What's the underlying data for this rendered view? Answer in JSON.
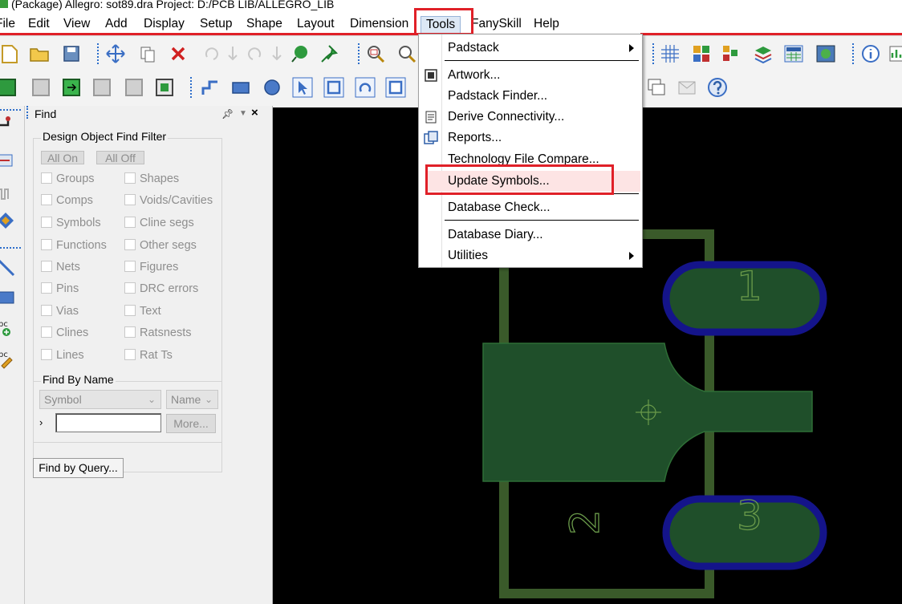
{
  "window": {
    "title": "(Package) Allegro: sot89.dra  Project: D:/PCB LIB/ALLEGRO_LIB"
  },
  "menubar": {
    "items": [
      "File",
      "Edit",
      "View",
      "Add",
      "Display",
      "Setup",
      "Shape",
      "Layout",
      "Dimension",
      "Tools",
      "FanySkill",
      "Help"
    ]
  },
  "tools_menu": {
    "items": [
      {
        "label": "Padstack",
        "submenu": true
      },
      {
        "label": "Artwork..."
      },
      {
        "label": "Padstack Finder..."
      },
      {
        "label": "Derive Connectivity..."
      },
      {
        "label": "Reports..."
      },
      {
        "label": "Technology File Compare..."
      },
      {
        "label": "Update Symbols...",
        "highlighted": true
      },
      {
        "label": "Database Check..."
      },
      {
        "label": "Database Diary..."
      },
      {
        "label": "Utilities",
        "submenu": true
      }
    ]
  },
  "find_panel": {
    "title": "Find",
    "pin_icon": "pin-icon",
    "close_icon": "close-icon",
    "filter_group_title": "Design Object Find Filter",
    "all_on_label": "All On",
    "all_off_label": "All Off",
    "checkboxes_left": [
      "Groups",
      "Comps",
      "Symbols",
      "Functions",
      "Nets",
      "Pins",
      "Vias",
      "Clines",
      "Lines"
    ],
    "checkboxes_right": [
      "Shapes",
      "Voids/Cavities",
      "Cline segs",
      "Other segs",
      "Figures",
      "DRC errors",
      "Text",
      "Ratsnests",
      "Rat Ts"
    ],
    "find_by_name_title": "Find By Name",
    "type_select": "Symbol",
    "name_select": "Name",
    "name_input_value": "",
    "more_label": "More...",
    "find_by_query_label": "Find by Query..."
  },
  "canvas": {
    "pin_labels": [
      "1",
      "3",
      "2"
    ]
  },
  "colors": {
    "highlight_red": "#e02028",
    "pad_fill": "#1f4f2a",
    "pad_outline": "#14148a",
    "silk": "#3a5a2a",
    "canvas_bg": "#000000"
  }
}
